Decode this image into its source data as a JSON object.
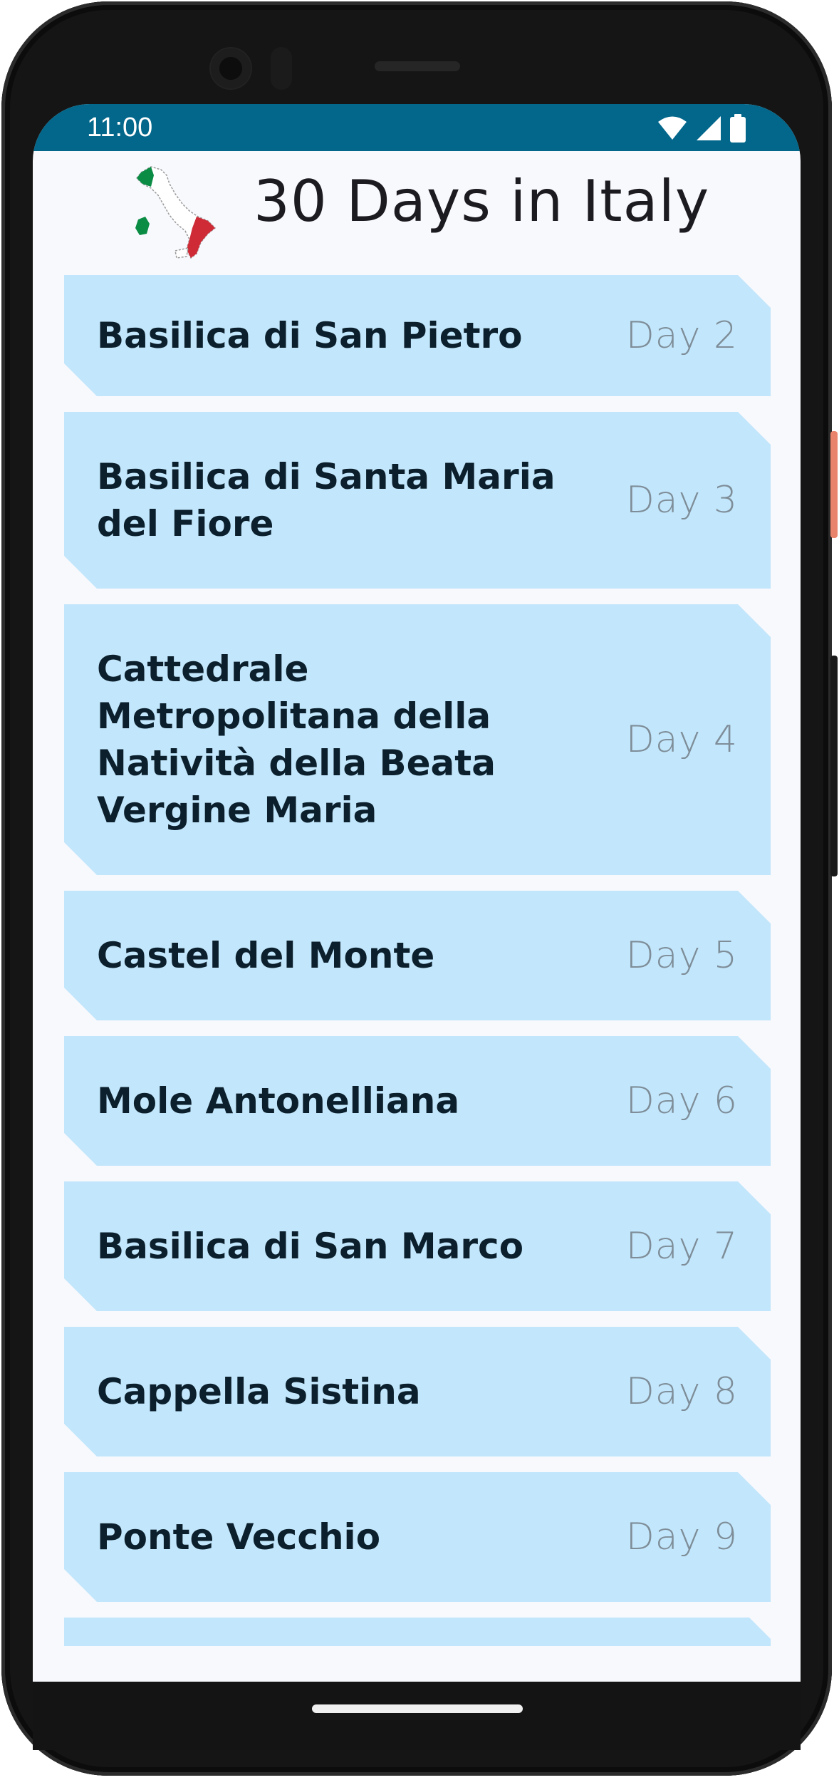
{
  "status_bar": {
    "time": "11:00",
    "icons": [
      "wifi-icon",
      "cellular-signal-icon",
      "battery-icon"
    ],
    "background": "#02678b"
  },
  "header": {
    "title": "30 Days in Italy",
    "logo_icon": "italy-map-flag-icon"
  },
  "destinations": [
    {
      "title": "Basilica di San Pietro",
      "day": "Day 2"
    },
    {
      "title": "Basilica di Santa Maria del Fiore",
      "day": "Day 3"
    },
    {
      "title": "Cattedrale Metropolitana della Natività della Beata Vergine Maria",
      "day": "Day 4"
    },
    {
      "title": "Castel del Monte",
      "day": "Day 5"
    },
    {
      "title": "Mole Antonelliana",
      "day": "Day 6"
    },
    {
      "title": "Basilica di San Marco",
      "day": "Day 7"
    },
    {
      "title": "Cappella Sistina",
      "day": "Day 8"
    },
    {
      "title": "Ponte Vecchio",
      "day": "Day 9"
    }
  ],
  "colors": {
    "card_background": "#c2e6fb",
    "card_title": "#0b1f2c",
    "card_day": "#7e8d98",
    "screen_background": "#f8f9fd",
    "flag_green": "#0b8c45",
    "flag_red": "#ce2b37"
  }
}
